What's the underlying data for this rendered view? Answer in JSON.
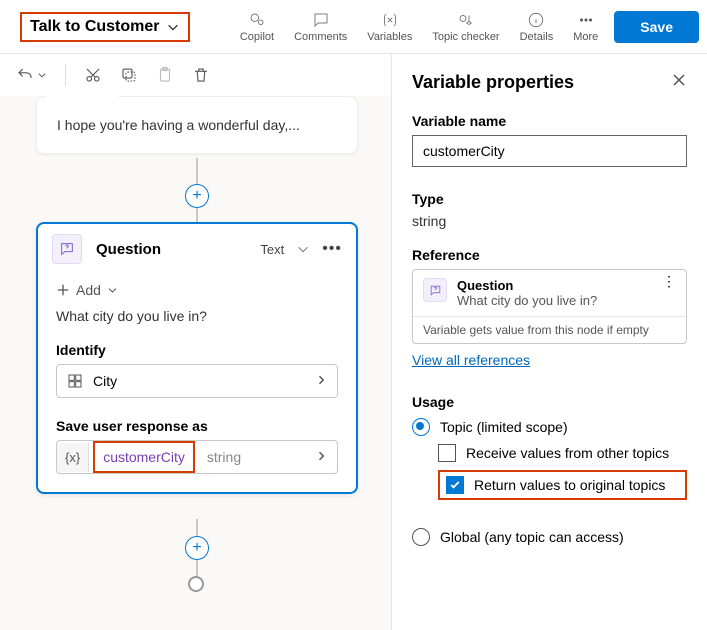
{
  "header": {
    "topic_name": "Talk to Customer",
    "actions": {
      "copilot": "Copilot",
      "comments": "Comments",
      "variables": "Variables",
      "topic_checker": "Topic checker",
      "details": "Details",
      "more": "More"
    },
    "save": "Save"
  },
  "canvas": {
    "message_text": "I hope you're having a wonderful day,...",
    "question": {
      "title": "Question",
      "output_type": "Text",
      "add_label": "Add",
      "prompt": "What city do you live in?",
      "identify_label": "Identify",
      "identify_value": "City",
      "save_as_label": "Save user response as",
      "var_token": "{x}",
      "var_name": "customerCity",
      "var_type": "string"
    }
  },
  "panel": {
    "title": "Variable properties",
    "name_label": "Variable name",
    "name_value": "customerCity",
    "type_label": "Type",
    "type_value": "string",
    "reference_label": "Reference",
    "reference": {
      "node_type": "Question",
      "node_text": "What city do you live in?",
      "note": "Variable gets value from this node if empty"
    },
    "view_all": "View all references",
    "usage_label": "Usage",
    "scope_topic": "Topic (limited scope)",
    "receive": "Receive values from other topics",
    "return": "Return values to original topics",
    "scope_global": "Global (any topic can access)"
  }
}
